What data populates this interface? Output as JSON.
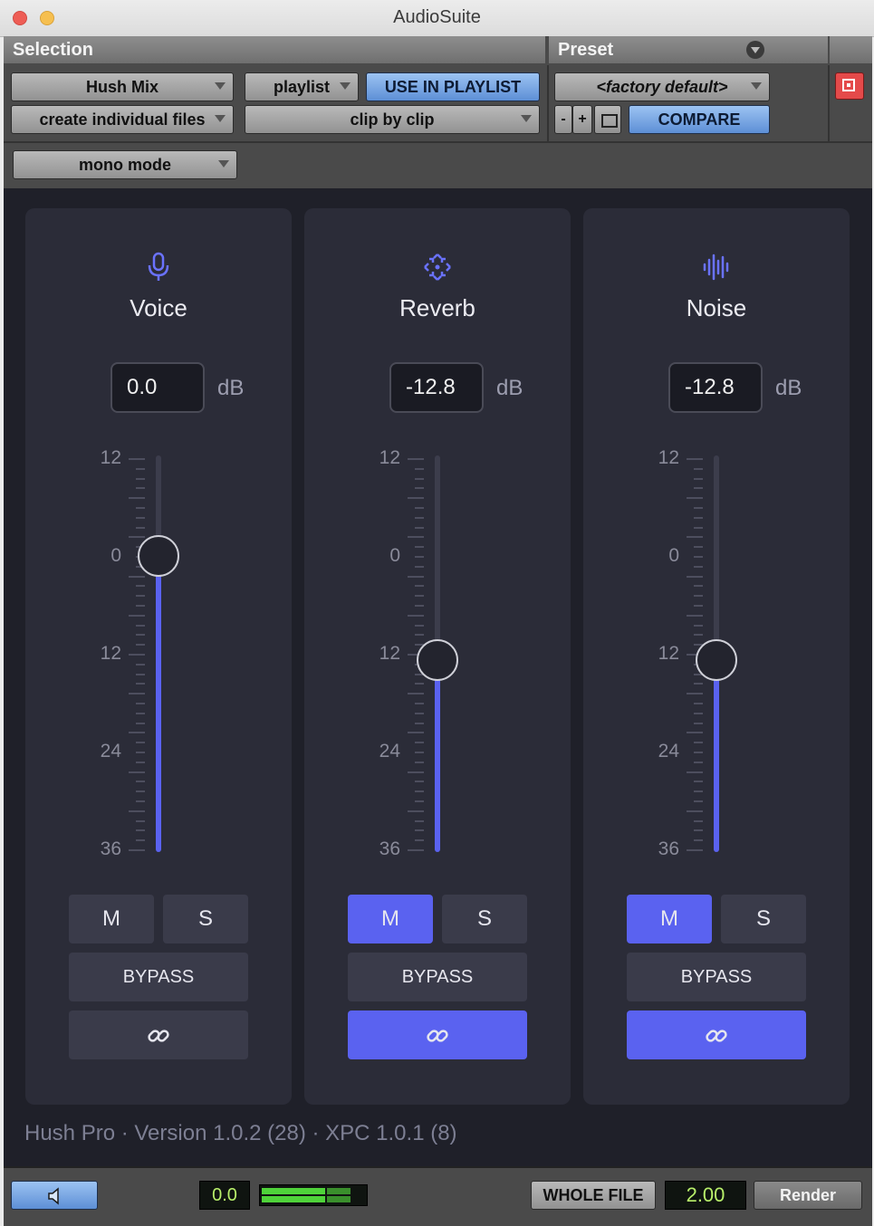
{
  "window": {
    "title": "AudioSuite"
  },
  "header": {
    "selection_label": "Selection",
    "preset_label": "Preset",
    "plugin_select": "Hush Mix",
    "playlist_select": "playlist",
    "use_in_playlist": "USE IN PLAYLIST",
    "file_mode": "create individual files",
    "clip_mode": "clip by clip",
    "preset_value": "<factory default>",
    "preset_minus": "-",
    "preset_plus": "+",
    "compare": "COMPARE",
    "mono_mode": "mono mode"
  },
  "channels": [
    {
      "name": "Voice",
      "icon": "microphone-icon",
      "db": "0.0",
      "unit": "dB",
      "value_db": 0.0,
      "mute_on": false,
      "link_on": false
    },
    {
      "name": "Reverb",
      "icon": "reverb-icon",
      "db": "-12.8",
      "unit": "dB",
      "value_db": -12.8,
      "mute_on": true,
      "link_on": true
    },
    {
      "name": "Noise",
      "icon": "waveform-icon",
      "db": "-12.8",
      "unit": "dB",
      "value_db": -12.8,
      "mute_on": true,
      "link_on": true
    }
  ],
  "scale_labels": [
    "12",
    "0",
    "12",
    "24",
    "36"
  ],
  "buttons": {
    "mute": "M",
    "solo": "S",
    "bypass": "BYPASS"
  },
  "footer": {
    "version": "Hush Pro · Version 1.0.2 (28) · XPC 1.0.1 (8)"
  },
  "bottom": {
    "gain": "0.0",
    "whole_file": "WHOLE FILE",
    "handle": "2.00",
    "render": "Render"
  },
  "colors": {
    "accent": "#5a62f0",
    "panel": "#2b2c38",
    "background": "#1f2029"
  }
}
